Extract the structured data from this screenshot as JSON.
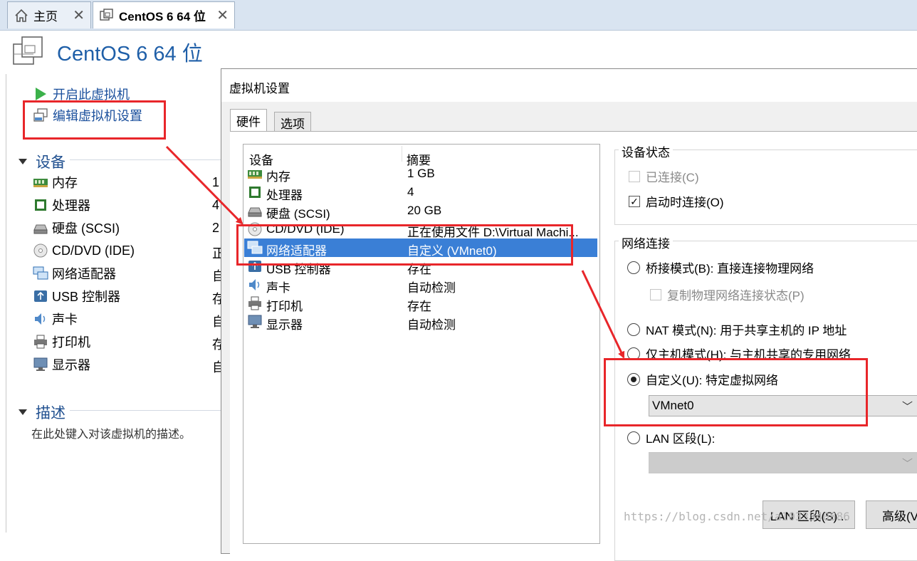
{
  "tabs": [
    {
      "label": "主页",
      "icon": "home-icon"
    },
    {
      "label": "CentOS 6 64 位",
      "icon": "vm-icon"
    }
  ],
  "vm": {
    "title": "CentOS 6 64 位"
  },
  "commands": {
    "power_on": "开启此虚拟机",
    "edit_settings": "编辑虚拟机设置"
  },
  "devices_section": {
    "title": "设备",
    "items": [
      {
        "name": "内存",
        "value": "1"
      },
      {
        "name": "处理器",
        "value": "4"
      },
      {
        "name": "硬盘 (SCSI)",
        "value": "2"
      },
      {
        "name": "CD/DVD (IDE)",
        "value": "正"
      },
      {
        "name": "网络适配器",
        "value": "自"
      },
      {
        "name": "USB 控制器",
        "value": "存"
      },
      {
        "name": "声卡",
        "value": "自"
      },
      {
        "name": "打印机",
        "value": "存"
      },
      {
        "name": "显示器",
        "value": "自"
      }
    ]
  },
  "description_section": {
    "title": "描述",
    "placeholder": "在此处键入对该虚拟机的描述。"
  },
  "dialog": {
    "title": "虚拟机设置",
    "tabs": [
      "硬件",
      "选项"
    ],
    "list": {
      "col_device": "设备",
      "col_summary": "摘要",
      "rows": [
        {
          "name": "内存",
          "summary": "1 GB",
          "icon": "memory-icon"
        },
        {
          "name": "处理器",
          "summary": "4",
          "icon": "cpu-icon"
        },
        {
          "name": "硬盘 (SCSI)",
          "summary": "20 GB",
          "icon": "hdd-icon"
        },
        {
          "name": "CD/DVD (IDE)",
          "summary": "正在使用文件 D:\\Virtual Machi...",
          "icon": "cd-icon"
        },
        {
          "name": "网络适配器",
          "summary": "自定义 (VMnet0)",
          "icon": "network-icon"
        },
        {
          "name": "USB 控制器",
          "summary": "存在",
          "icon": "usb-icon"
        },
        {
          "name": "声卡",
          "summary": "自动检测",
          "icon": "sound-icon"
        },
        {
          "name": "打印机",
          "summary": "存在",
          "icon": "printer-icon"
        },
        {
          "name": "显示器",
          "summary": "自动检测",
          "icon": "monitor-icon"
        }
      ],
      "selected_index": 4
    },
    "device_status": {
      "title": "设备状态",
      "connected": {
        "label": "已连接(C)",
        "checked": false,
        "enabled": false
      },
      "connect_on_start": {
        "label": "启动时连接(O)",
        "checked": true,
        "enabled": true
      }
    },
    "network": {
      "title": "网络连接",
      "bridged": "桥接模式(B): 直接连接物理网络",
      "replicate": "复制物理网络连接状态(P)",
      "nat": "NAT 模式(N): 用于共享主机的 IP 地址",
      "host_only": "仅主机模式(H): 与主机共享的专用网络",
      "custom": "自定义(U): 特定虚拟网络",
      "custom_value": "VMnet0",
      "lan": "LAN 区段(L):",
      "selected": "custom"
    },
    "buttons": {
      "lan_segments": "LAN 区段(S)...",
      "advanced": "高级(V"
    }
  },
  "watermark": "https://blog.csdn.net/a1033340886",
  "colors": {
    "accent": "#1f5fa8",
    "selection": "#3a7fd6",
    "annotation": "#e8262a"
  }
}
